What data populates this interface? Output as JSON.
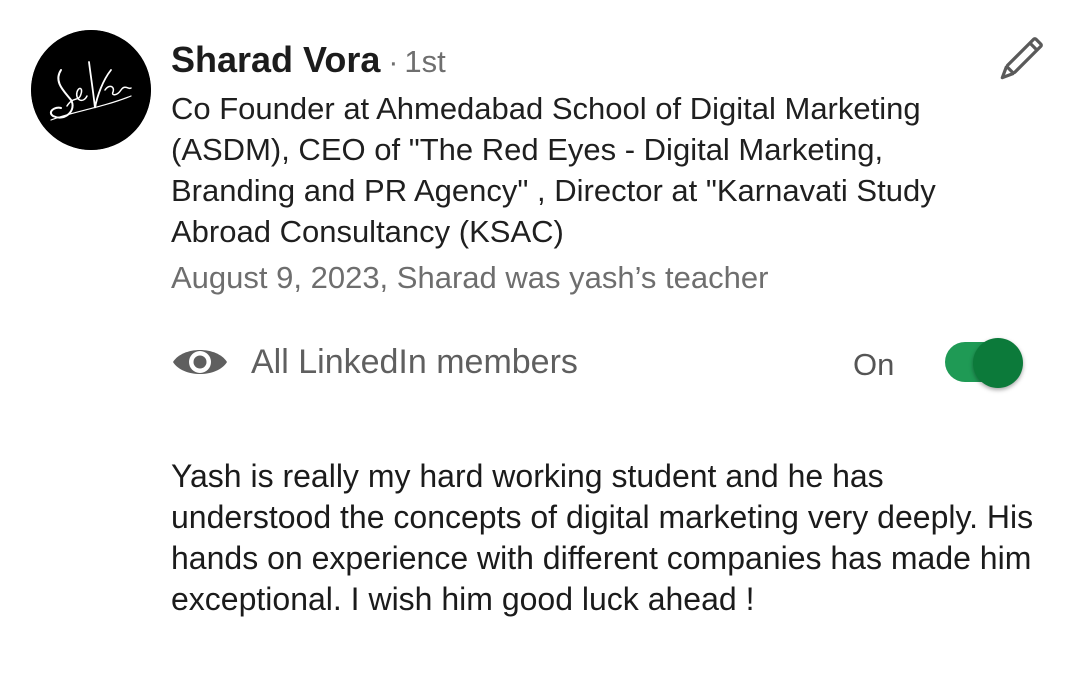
{
  "recommender": {
    "name": "Sharad Vora",
    "separator": "·",
    "degree": "1st",
    "headline": "Co Founder at Ahmedabad School of Digital Marketing (ASDM), CEO of \"The Red Eyes - Digital Marketing, Branding and PR Agency\" , Director at \"Karnavati Study Abroad Consultancy (KSAC)",
    "meta": "August 9, 2023, Sharad was yash’s teacher"
  },
  "visibility": {
    "icon": "eye-icon",
    "label": "All LinkedIn members",
    "state_label": "On",
    "toggle_on": true
  },
  "recommendation_text": "Yash is really my hard working student and he has understood the concepts of digital marketing very deeply. His hands on experience with different companies has made him exceptional. I wish him good luck ahead !",
  "icons": {
    "edit": "pencil-icon",
    "avatar": "avatar"
  },
  "colors": {
    "toggle_track": "#1f9a55",
    "toggle_knob": "#0c7a3a",
    "primary_text": "#1f1f1f",
    "secondary_text": "#6e6e6e"
  }
}
